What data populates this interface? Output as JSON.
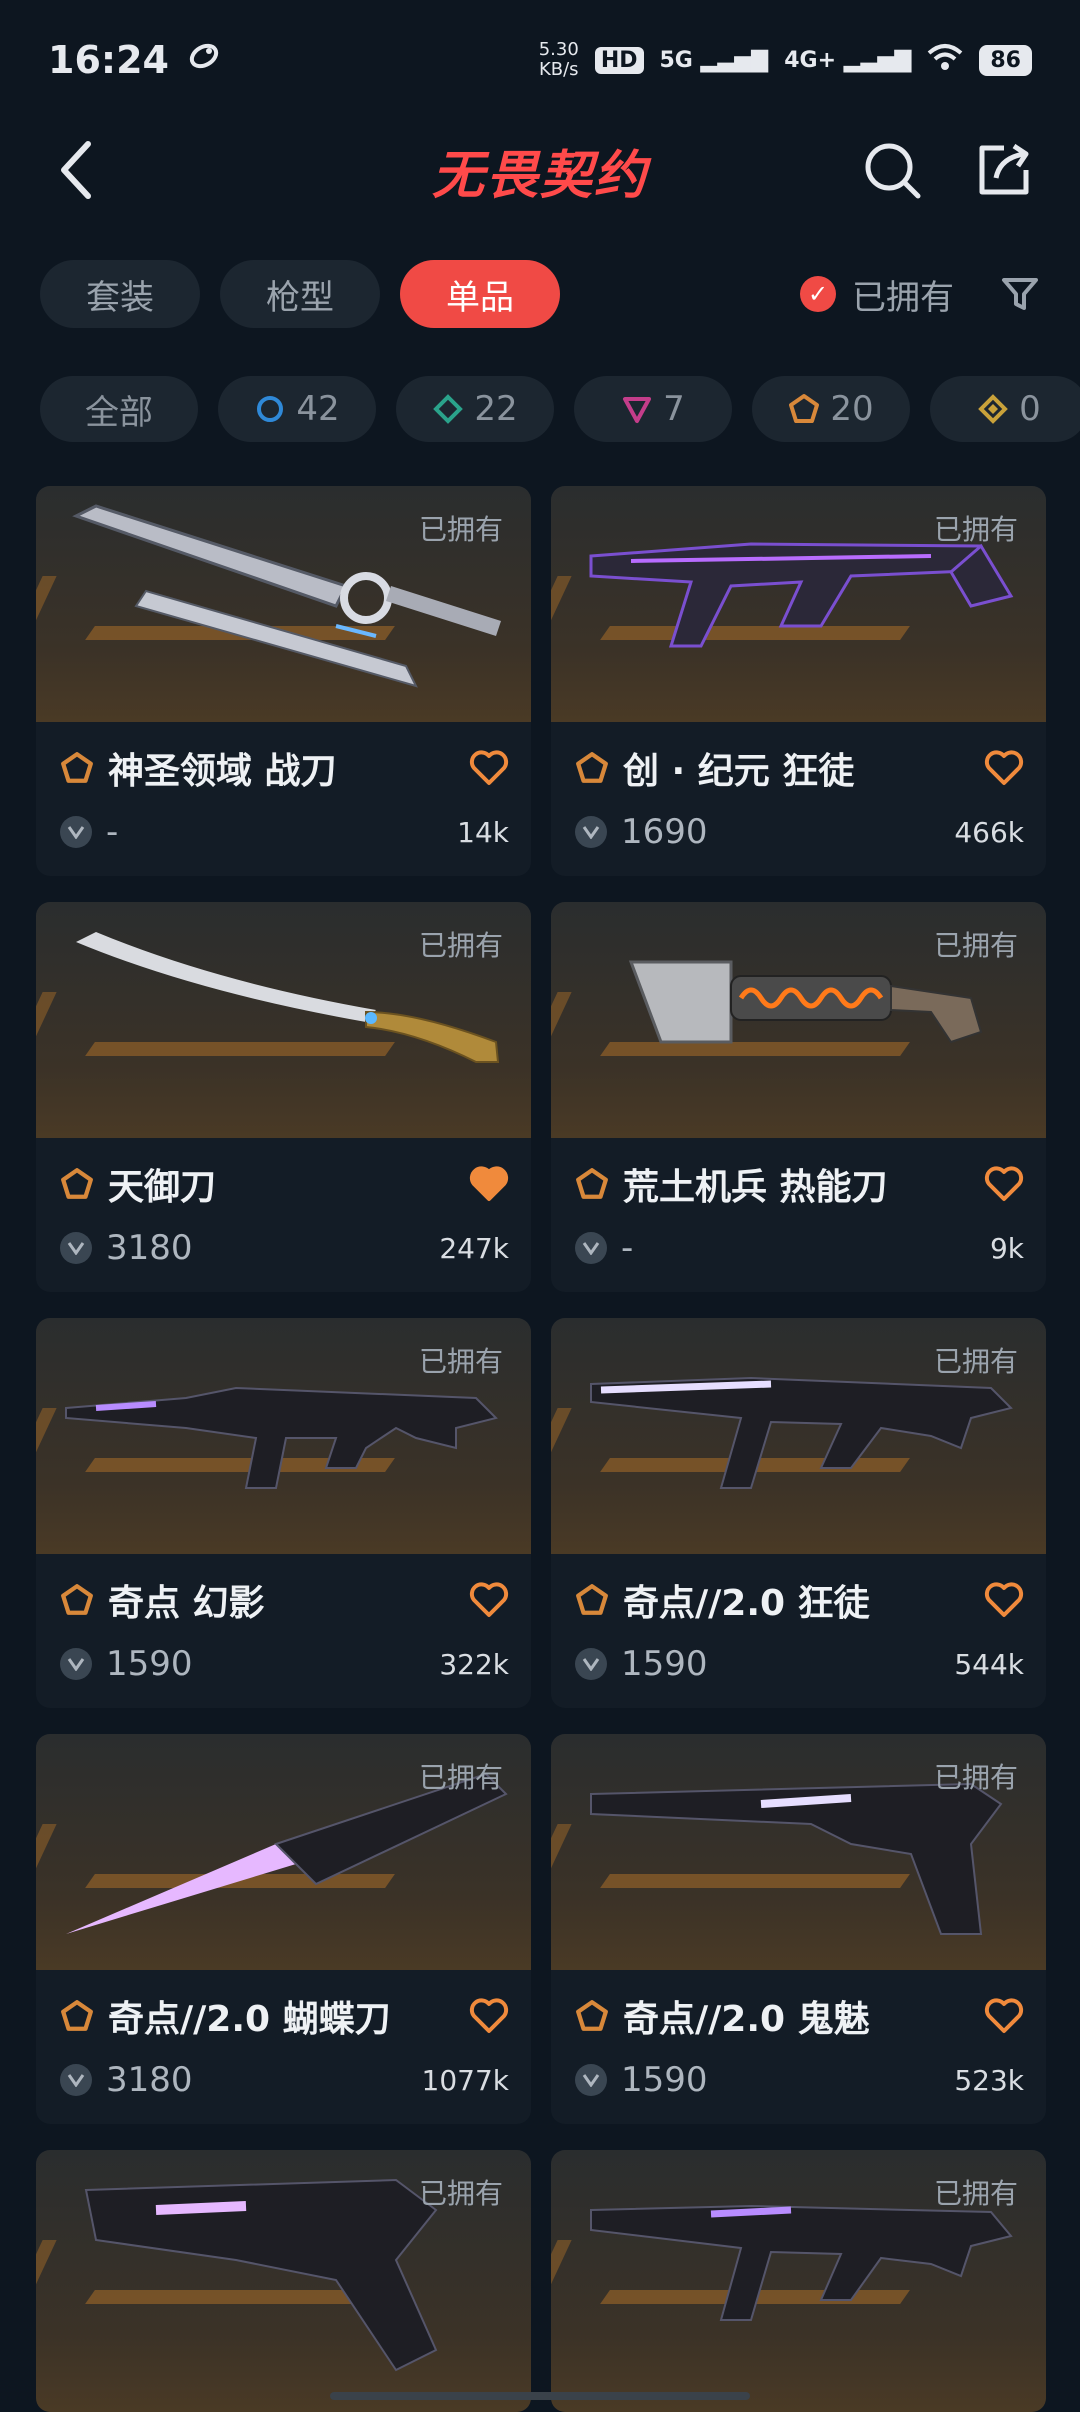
{
  "status": {
    "time": "16:24",
    "speed_top": "5.30",
    "speed_bottom": "KB/s",
    "hd": "HD",
    "net5g": "5G",
    "net4g": "4G+",
    "battery": "86"
  },
  "header": {
    "title": "无畏契约"
  },
  "tabs": [
    {
      "label": "套装"
    },
    {
      "label": "枪型"
    },
    {
      "label": "单品"
    }
  ],
  "owned_filter": {
    "label": "已拥有",
    "checked": true
  },
  "chips": [
    {
      "label": "全部"
    },
    {
      "count": "42",
      "color": "#2f89d8"
    },
    {
      "count": "22",
      "color": "#2aa38b"
    },
    {
      "count": "7",
      "color": "#c43d8a"
    },
    {
      "count": "20",
      "color": "#d8883a"
    },
    {
      "count": "0",
      "color": "#c9a23a"
    }
  ],
  "items": [
    {
      "owned": "已拥有",
      "name": "神圣领域 战刀",
      "price": "-",
      "likes": "14k",
      "liked": false
    },
    {
      "owned": "已拥有",
      "name": "创 · 纪元 狂徒",
      "price": "1690",
      "likes": "466k",
      "liked": false
    },
    {
      "owned": "已拥有",
      "name": "天御刀",
      "price": "3180",
      "likes": "247k",
      "liked": true
    },
    {
      "owned": "已拥有",
      "name": "荒土机兵 热能刀",
      "price": "-",
      "likes": "9k",
      "liked": false
    },
    {
      "owned": "已拥有",
      "name": "奇点 幻影",
      "price": "1590",
      "likes": "322k",
      "liked": false
    },
    {
      "owned": "已拥有",
      "name": "奇点//2.0 狂徒",
      "price": "1590",
      "likes": "544k",
      "liked": false
    },
    {
      "owned": "已拥有",
      "name": "奇点//2.0 蝴蝶刀",
      "price": "3180",
      "likes": "1077k",
      "liked": false
    },
    {
      "owned": "已拥有",
      "name": "奇点//2.0 鬼魅",
      "price": "1590",
      "likes": "523k",
      "liked": false
    },
    {
      "owned": "已拥有"
    },
    {
      "owned": "已拥有"
    }
  ],
  "colors": {
    "accent": "#f04a45",
    "heart": "#f08a3c",
    "tier": "#d8883a"
  }
}
